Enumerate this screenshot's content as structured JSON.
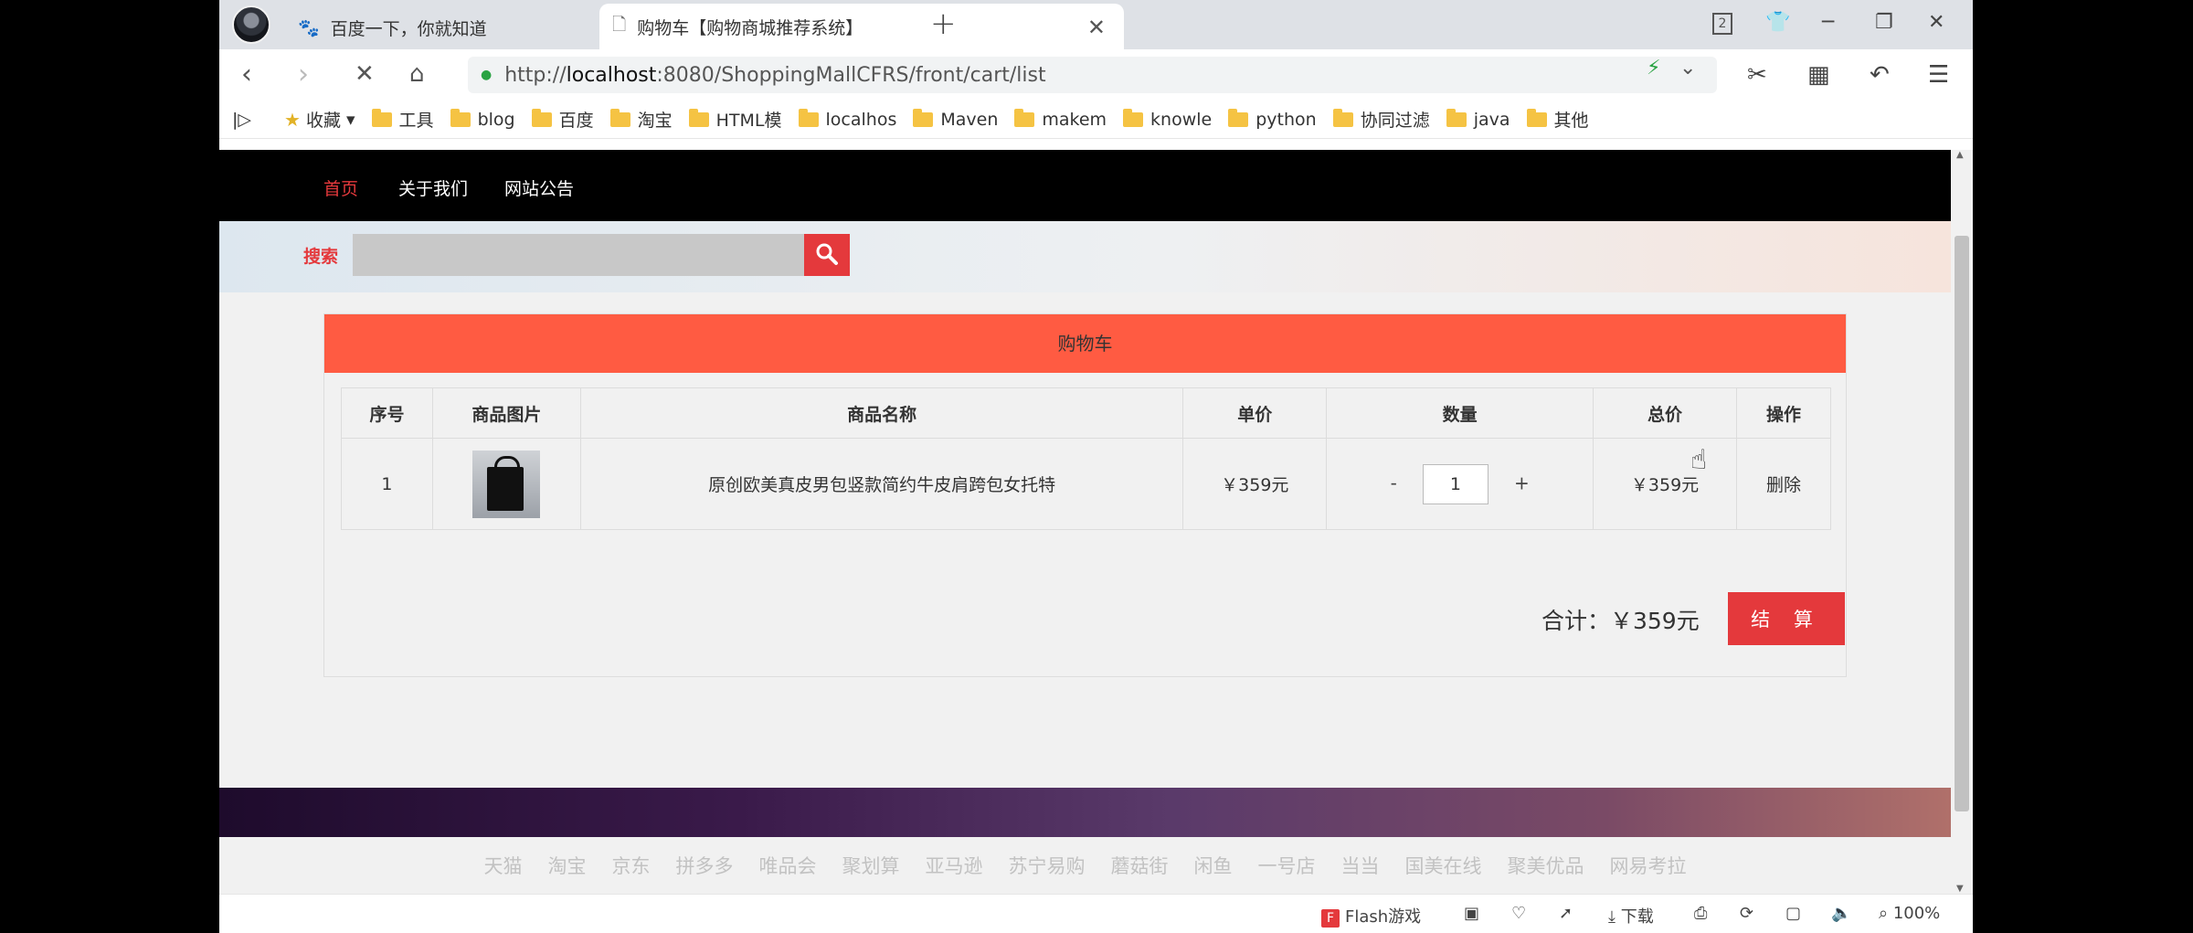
{
  "tabs": [
    {
      "title": "百度一下，你就知道",
      "icon": "baidu-paw-icon"
    },
    {
      "title": "购物车【购物商城推荐系统】",
      "icon": "page-icon"
    }
  ],
  "window": {
    "tab_count_badge": "2"
  },
  "address": {
    "scheme": "http://",
    "host": "localhost",
    "rest": ":8080/ShoppingMallCFRS/front/cart/list"
  },
  "bookmarks": [
    "收藏",
    "工具",
    "blog",
    "百度",
    "淘宝",
    "HTML模",
    "localhos",
    "Maven",
    "makem",
    "knowle",
    "python",
    "协同过滤",
    "java",
    "其他"
  ],
  "site_nav": {
    "home": "首页",
    "about": "关于我们",
    "notice": "网站公告"
  },
  "search": {
    "label": "搜索",
    "value": ""
  },
  "cart": {
    "title": "购物车",
    "columns": [
      "序号",
      "商品图片",
      "商品名称",
      "单价",
      "数量",
      "总价",
      "操作"
    ],
    "rows": [
      {
        "index": "1",
        "name": "原创欧美真皮男包竖款简约牛皮肩跨包女托特",
        "price": "￥359元",
        "qty_minus": "-",
        "qty": "1",
        "qty_plus": "+",
        "total": "￥359元",
        "action": "删除"
      }
    ],
    "total_text": "合计：￥359元",
    "checkout_label": "结 算"
  },
  "footer_links": [
    "天猫",
    "淘宝",
    "京东",
    "拼多多",
    "唯品会",
    "聚划算",
    "亚马逊",
    "苏宁易购",
    "蘑菇街",
    "闲鱼",
    "一号店",
    "当当",
    "国美在线",
    "聚美优品",
    "网易考拉"
  ],
  "statusbar": {
    "flash": "Flash游戏",
    "download": "下载",
    "zoom": "100%"
  }
}
